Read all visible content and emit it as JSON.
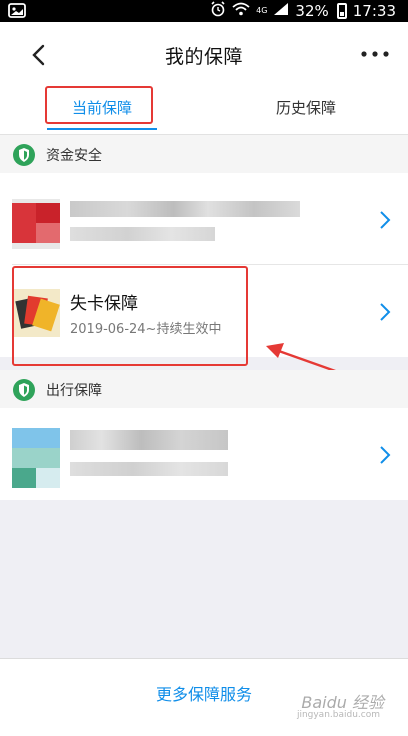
{
  "status_bar": {
    "network": "4G",
    "battery": "32%",
    "time": "17:33"
  },
  "navbar": {
    "title": "我的保障"
  },
  "tabs": [
    {
      "label": "当前保障",
      "active": true
    },
    {
      "label": "历史保障",
      "active": false
    }
  ],
  "sections": [
    {
      "label": "资金安全",
      "items": [
        {
          "title": "",
          "subtitle": "",
          "blurred": true
        },
        {
          "title": "失卡保障",
          "subtitle": "2019-06-24~持续生效中",
          "blurred": false
        }
      ]
    },
    {
      "label": "出行保障",
      "items": [
        {
          "title": "",
          "subtitle": "",
          "blurred": true
        }
      ]
    }
  ],
  "footer": {
    "link": "更多保障服务"
  },
  "watermark": {
    "text": "Baidu 经验",
    "sub": "jingyan.baidu.com"
  },
  "colors": {
    "accent": "#108ee9",
    "highlight": "#e53935",
    "shield_green": "#2fa35a"
  },
  "icons": {
    "back": "back-arrow-icon",
    "more": "more-dots-icon",
    "shield": "shield-icon",
    "chevron": "chevron-right-icon"
  }
}
